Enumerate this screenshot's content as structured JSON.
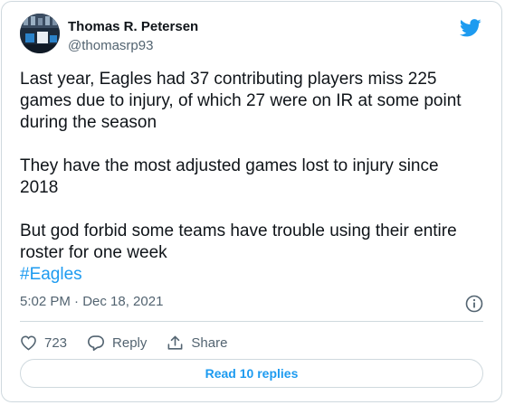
{
  "author": {
    "name": "Thomas R. Petersen",
    "handle": "@thomasrp93",
    "avatar_icon": "profile-photo",
    "platform_icon": "twitter-bird-icon"
  },
  "tweet": {
    "paragraphs": [
      "Last year, Eagles had 37 contributing players miss 225 games due to injury, of which 27 were on IR at some point during the season",
      "They have the most adjusted games lost to injury since 2018",
      "But god forbid some teams have trouble using their entire roster for one week"
    ],
    "hashtag": "#Eagles",
    "timestamp": "5:02 PM · Dec 18, 2021"
  },
  "actions": {
    "like_count": "723",
    "reply_label": "Reply",
    "share_label": "Share"
  },
  "read_replies_label": "Read 10 replies",
  "colors": {
    "accent": "#1d9bf0",
    "secondary_text": "#536471",
    "border": "#cfd9de",
    "text": "#0f1419"
  }
}
